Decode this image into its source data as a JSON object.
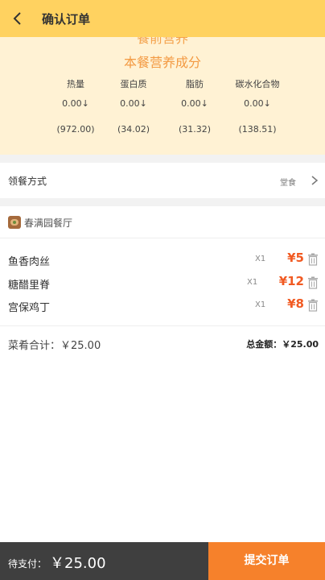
{
  "header": {
    "title": "确认订单",
    "back_icon": "chevron-left-icon"
  },
  "nutrition": {
    "partial_heading": "餐前营养",
    "title": "本餐营养成分",
    "columns": [
      {
        "label": "热量",
        "value": "0.00↓",
        "total": "(972.00)"
      },
      {
        "label": "蛋白质",
        "value": "0.00↓",
        "total": "(34.02)"
      },
      {
        "label": "脂肪",
        "value": "0.00↓",
        "total": "(31.32)"
      },
      {
        "label": "碳水化合物",
        "value": "0.00↓",
        "total": "(138.51)"
      }
    ]
  },
  "pickup": {
    "label": "领餐方式",
    "value": "堂食",
    "chevron_icon": "chevron-right-icon"
  },
  "restaurant": {
    "name": "春满园餐厅",
    "icon": "restaurant-icon"
  },
  "items": [
    {
      "name": "鱼香肉丝",
      "qty": "X1",
      "price": "¥5"
    },
    {
      "name": "糖醋里脊",
      "qty": "X1",
      "price": "¥12"
    },
    {
      "name": "宫保鸡丁",
      "qty": "X1",
      "price": "¥8"
    }
  ],
  "summary": {
    "subtotal": "菜肴合计：￥25.00",
    "total": "总金额：￥25.00"
  },
  "footer": {
    "pay_label": "待支付：",
    "pay_amount": "￥25.00",
    "submit_label": "提交订单"
  },
  "colors": {
    "header_bg": "#ffd260",
    "nutrition_bg": "#fff2d4",
    "accent": "#f6812b",
    "price": "#f15a22",
    "footer_bg": "#3f3f3f"
  }
}
